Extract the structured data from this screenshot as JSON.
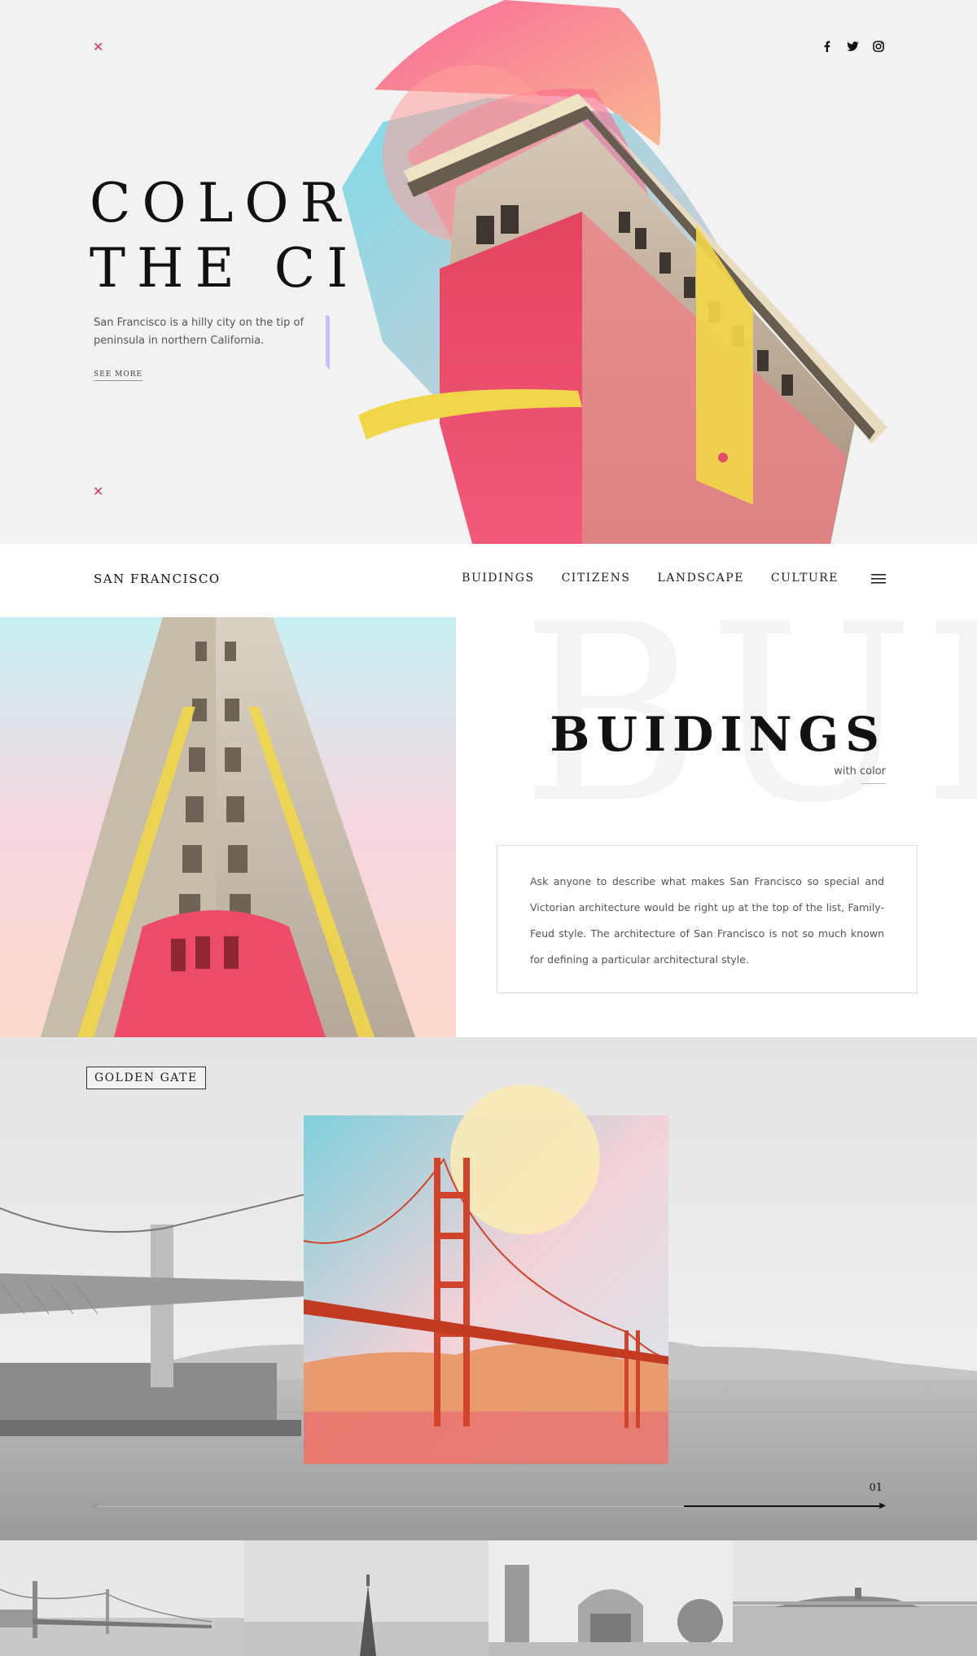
{
  "hero": {
    "title_line1": "COLOR",
    "title_line2": "THE CITY",
    "description": "San Francisco is a hilly city on the tip of peninsula in northern California.",
    "see_more": "SEE MORE",
    "close_icon": "close-icon",
    "accent_color": "#d7336a",
    "social": [
      "facebook-icon",
      "twitter-icon",
      "instagram-icon"
    ]
  },
  "nav": {
    "brand": "SAN FRANCISCO",
    "items": [
      "BUIDINGS",
      "CITIZENS",
      "LANDSCAPE",
      "CULTURE"
    ],
    "menu_icon": "hamburger-menu-icon"
  },
  "buildings": {
    "title": "BUIDINGS",
    "subtitle": "with color",
    "background_word": "BUI",
    "body": "Ask anyone to describe what makes San Francisco so special and Victorian architecture would be right up at the top of the list, Family-Feud style. The architecture of San Francisco is not so much known for defining a particular architectural style."
  },
  "golden_gate": {
    "tag": "GOLDEN GATE",
    "counter": "01",
    "progress": 0.25
  },
  "thumbnails": [
    "golden-gate-bridge",
    "transamerica-pyramid",
    "palace-of-fine-arts",
    "alcatraz-island"
  ]
}
